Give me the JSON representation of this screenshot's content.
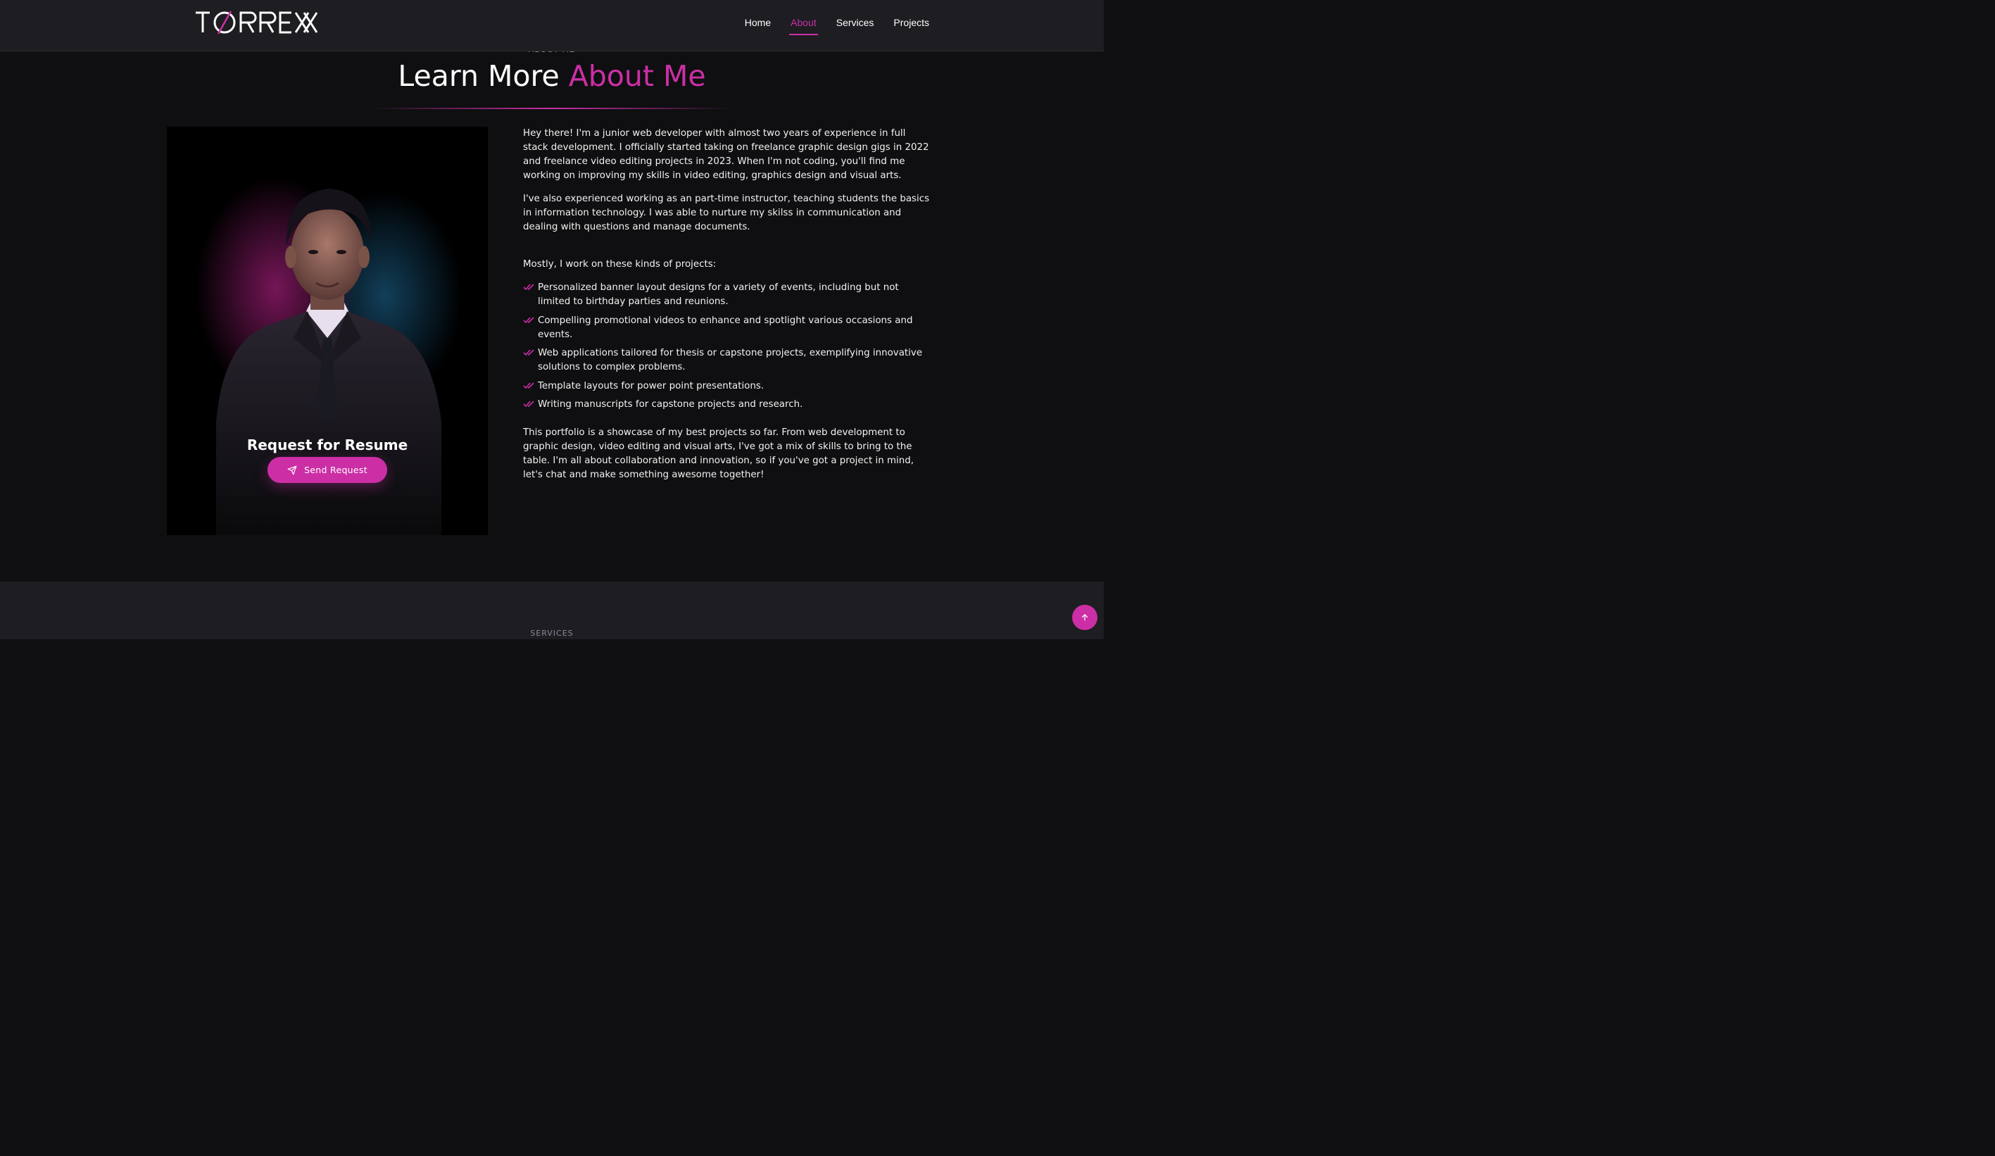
{
  "header": {
    "logo": "TORREXX",
    "nav": [
      {
        "label": "Home"
      },
      {
        "label": "About",
        "active": true
      },
      {
        "label": "Services"
      },
      {
        "label": "Projects"
      }
    ]
  },
  "about": {
    "eyebrow": "ABOUT ME",
    "title_main": "Learn More ",
    "title_accent": "About Me",
    "resume_title": "Request for Resume",
    "send_button": "Send Request",
    "paragraphs": [
      "Hey there! I'm a junior web developer with almost two years of experience in full stack development. I officially started taking on freelance graphic design gigs in 2022 and freelance video editing projects in 2023. When I'm not coding, you'll find me working on improving my skills in video editing, graphics design and visual arts.",
      "I've also experienced working as an part-time instructor, teaching students the basics in information technology. I was able to nurture my skilss in communication and dealing with questions and manage documents.",
      "Mostly, I work on these kinds of projects:",
      "This portfolio is a showcase of my best projects so far. From web development to graphic design, video editing and visual arts, I've got a mix of skills to bring to the table. I'm all about collaboration and innovation, so if you've got a project in mind, let's chat and make something awesome together!"
    ],
    "projects": [
      "Personalized banner layout designs for a variety of events, including but not limited to birthday parties and reunions.",
      "Compelling promotional videos to enhance and spotlight various occasions and events.",
      "Web applications tailored for thesis or capstone projects, exemplifying innovative solutions to complex problems.",
      "Template layouts for power point presentations.",
      "Writing manuscripts for capstone projects and research."
    ]
  },
  "services": {
    "eyebrow": "SERVICES"
  },
  "colors": {
    "accent": "#cc2fa5",
    "background": "#0f0f11",
    "header": "#1d1d22"
  },
  "icons": {
    "send": "paper-plane-icon",
    "check": "double-check-icon",
    "scroll_top": "arrow-up-icon"
  }
}
